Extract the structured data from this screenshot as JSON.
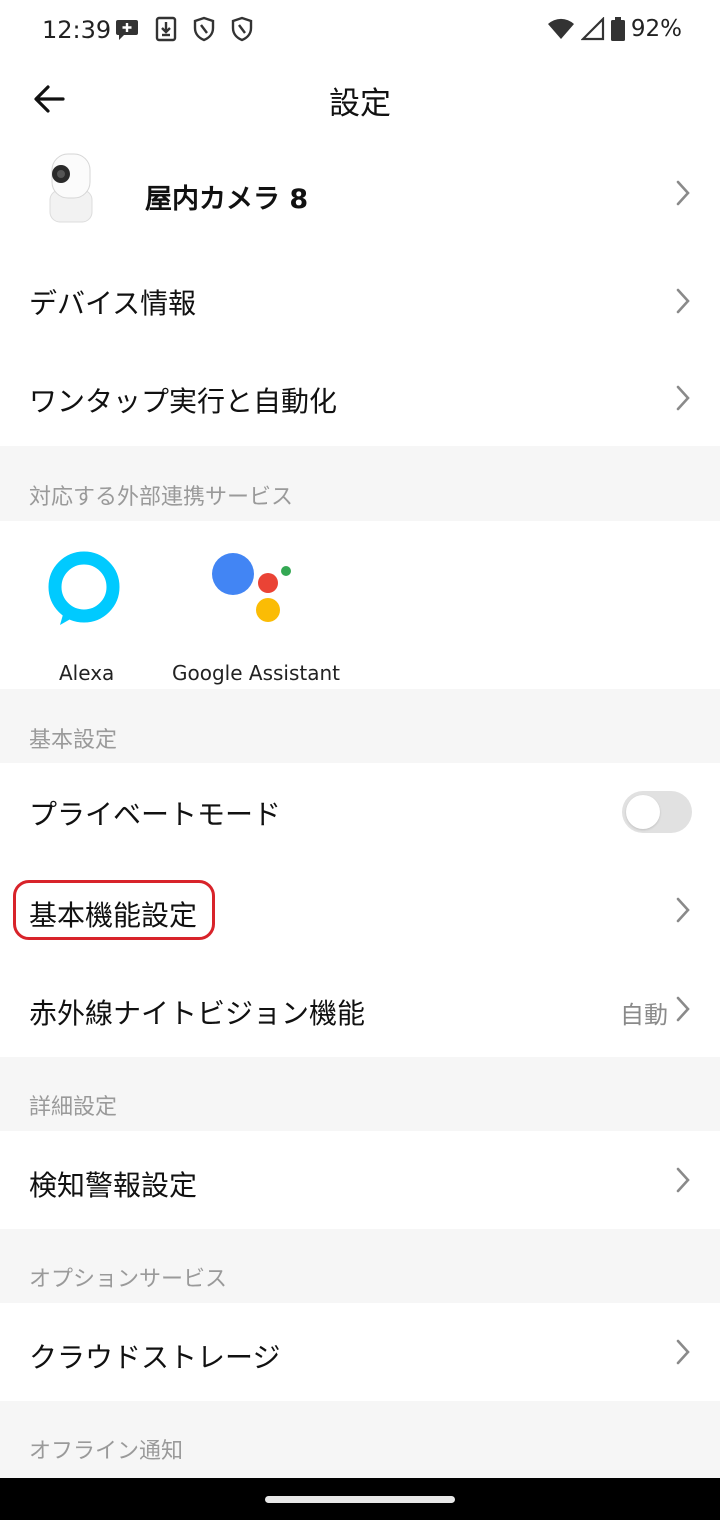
{
  "status_bar": {
    "time": "12:39",
    "battery": "92%",
    "left_icons": [
      "chat-plus-icon",
      "download-icon",
      "shield-icon",
      "shield-icon"
    ],
    "right_icons": [
      "wifi-icon",
      "signal-icon",
      "battery-icon"
    ]
  },
  "header": {
    "title": "設定",
    "back_icon": "arrow-left-icon"
  },
  "device": {
    "name": "屋内カメラ 8"
  },
  "rows_top": [
    {
      "label": "デバイス情報"
    },
    {
      "label": "ワンタップ実行と自動化"
    }
  ],
  "sections": {
    "external": "対応する外部連携サービス",
    "basic": "基本設定",
    "advanced": "詳細設定",
    "options": "オプションサービス",
    "offline": "オフライン通知"
  },
  "services": [
    {
      "name": "Alexa",
      "color": "#00caff"
    },
    {
      "name": "Google Assistant",
      "colors": [
        "#4285f4",
        "#ea4335",
        "#fbbc05",
        "#34a853"
      ]
    }
  ],
  "basic": {
    "privacy_mode": {
      "label": "プライベートモード",
      "enabled": false
    },
    "basic_functions": {
      "label": "基本機能設定"
    },
    "night_vision": {
      "label": "赤外線ナイトビジョン機能",
      "value": "自動"
    }
  },
  "advanced": {
    "detection_alert": {
      "label": "検知警報設定"
    }
  },
  "options": {
    "cloud_storage": {
      "label": "クラウドストレージ"
    }
  },
  "colors": {
    "highlight": "#d8232a",
    "muted_text": "#9a9a9a"
  }
}
